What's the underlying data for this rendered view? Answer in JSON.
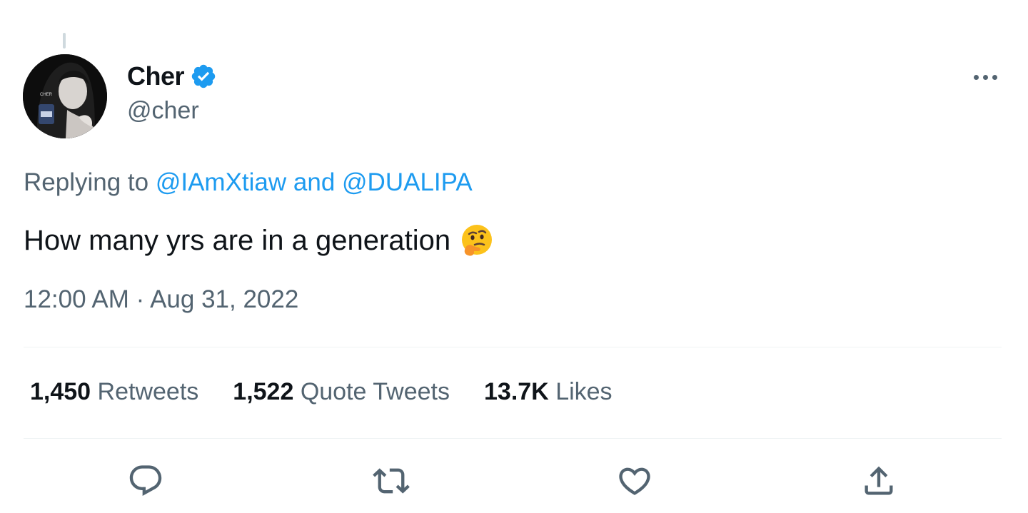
{
  "tweet": {
    "author": {
      "display_name": "Cher",
      "handle": "@cher",
      "verified": true,
      "avatar_text": "CHER"
    },
    "replying_prefix": "Replying to ",
    "reply_to_1": "@IAmXtiaw",
    "reply_conjunction": " and ",
    "reply_to_2": "@DUALIPA",
    "text": "How many yrs are in a generation",
    "emoji": "thinking-face-icon",
    "time": "12:00 AM",
    "separator": " · ",
    "date": "Aug 31, 2022"
  },
  "stats": {
    "retweets_count": "1,450",
    "retweets_label": "Retweets",
    "quotes_count": "1,522",
    "quotes_label": "Quote Tweets",
    "likes_count": "13.7K",
    "likes_label": "Likes"
  },
  "actions": [
    "reply-icon",
    "retweet-icon",
    "like-icon",
    "share-icon"
  ],
  "colors": {
    "link": "#1d9bf0",
    "secondary_text": "#536471",
    "primary_text": "#0f1419",
    "divider": "#eff3f4",
    "verified": "#1d9bf0"
  }
}
